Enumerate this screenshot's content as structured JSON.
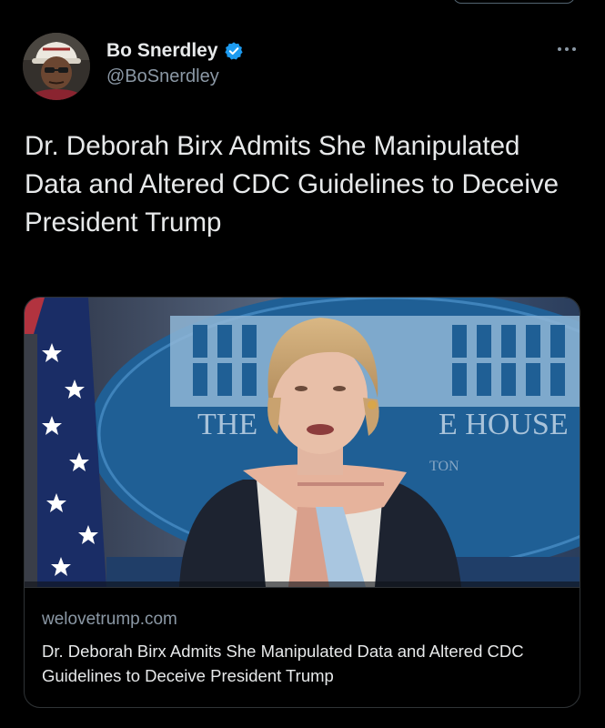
{
  "tweet": {
    "author": {
      "display_name": "Bo Snerdley",
      "handle": "@BoSnerdley",
      "verified": true,
      "avatar_icon": "user-avatar",
      "verified_icon": "verified-badge-icon"
    },
    "more_icon": "more-horizontal-icon",
    "text": "Dr. Deborah Birx Admits She Manipulated Data and Altered CDC Guidelines to Deceive President Trump",
    "link_card": {
      "domain": "welovetrump.com",
      "title": "Dr. Deborah Birx Admits She Manipulated Data and Altered CDC Guidelines to Deceive President Trump",
      "image": {
        "backdrop_text": "THE WHITE HOUSE",
        "visible_fragments": [
          "THE",
          "E HOUSE",
          "TON"
        ]
      }
    }
  },
  "colors": {
    "background": "#000000",
    "text_primary": "#e7e9ea",
    "text_secondary": "#8b98a5",
    "border": "#2f3336",
    "verified_blue": "#1d9bf0"
  }
}
